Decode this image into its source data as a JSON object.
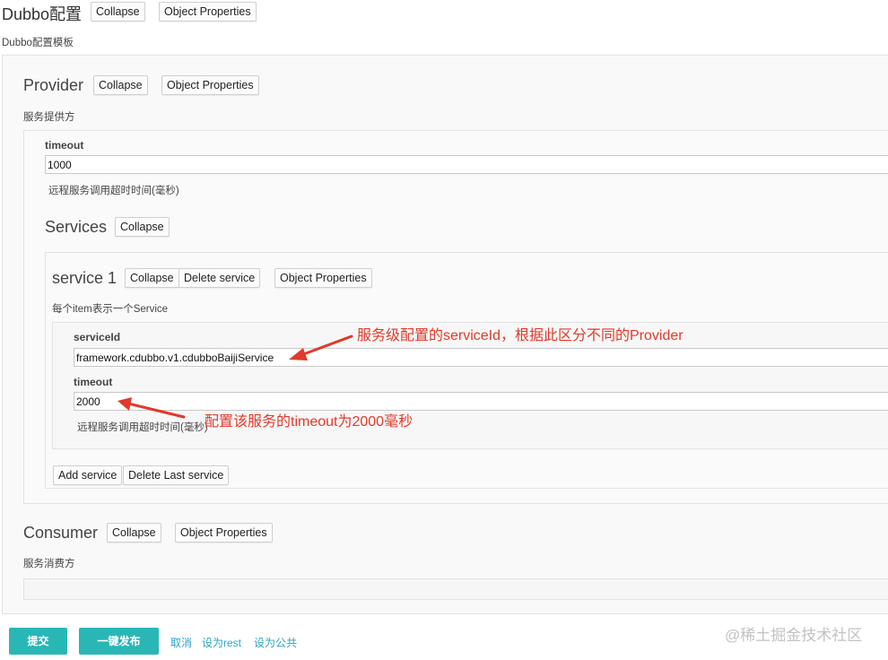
{
  "root": {
    "title": "Dubbo配置",
    "collapse_label": "Collapse",
    "object_properties_label": "Object Properties",
    "description": "Dubbo配置模板"
  },
  "provider": {
    "title": "Provider",
    "collapse_label": "Collapse",
    "object_properties_label": "Object Properties",
    "description": "服务提供方",
    "timeout_label": "timeout",
    "timeout_value": "1000",
    "timeout_description": "远程服务调用超时时间(毫秒)"
  },
  "services": {
    "title": "Services",
    "collapse_label": "Collapse",
    "add_label": "Add service",
    "delete_last_label": "Delete Last service",
    "items": [
      {
        "title": "service 1",
        "collapse_label": "Collapse",
        "delete_label": "Delete service",
        "object_properties_label": "Object Properties",
        "description": "每个item表示一个Service",
        "serviceid_label": "serviceId",
        "serviceid_value": "framework.cdubbo.v1.cdubboBaijiService",
        "timeout_label": "timeout",
        "timeout_value": "2000",
        "timeout_description": "远程服务调用超时时间(毫秒)"
      }
    ]
  },
  "consumer": {
    "title": "Consumer",
    "collapse_label": "Collapse",
    "object_properties_label": "Object Properties",
    "description": "服务消费方"
  },
  "annotations": {
    "serviceid_note": "服务级配置的serviceId，根据此区分不同的Provider",
    "timeout_note": "配置该服务的timeout为2000毫秒"
  },
  "footer": {
    "submit_label": "提交",
    "publish_label": "一键发布",
    "cancel_label": "取消",
    "set_rest_label": "设为rest",
    "set_public_label": "设为公共"
  },
  "watermark": "@稀土掘金技术社区",
  "colors": {
    "accent": "#29b7b6",
    "link": "#2aa3c6",
    "annotation": "#e03a2a"
  }
}
